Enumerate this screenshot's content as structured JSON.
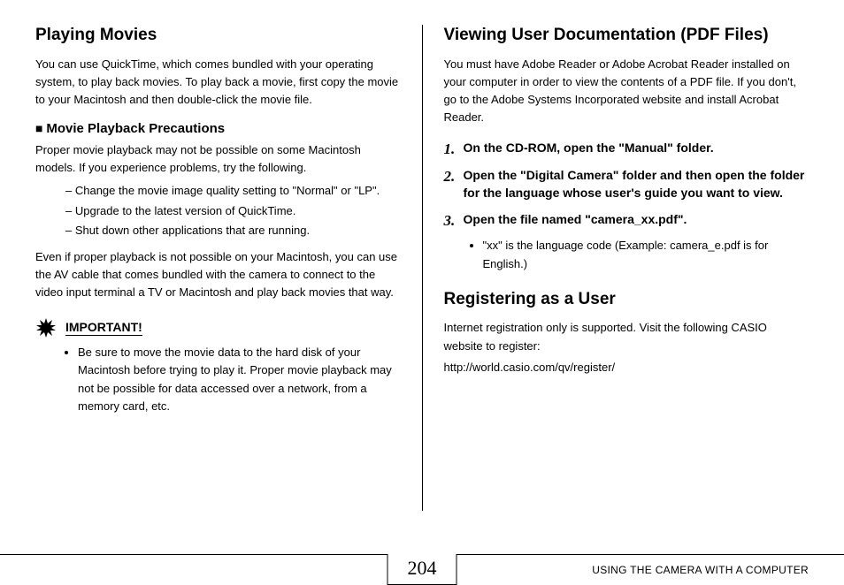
{
  "left": {
    "heading1": "Playing Movies",
    "para1": "You can use QuickTime, which comes bundled with your operating system, to play back movies. To play back a movie, first copy the movie to your Macintosh and then double-click the movie file.",
    "sub1": "Movie Playback Precautions",
    "para2": "Proper movie playback may not be possible on some Macintosh models. If you experience problems, try the following.",
    "dashes": [
      "Change the movie image quality setting to \"Normal\" or \"LP\".",
      "Upgrade to the latest version of QuickTime.",
      "Shut down other applications that are running."
    ],
    "para3": "Even if proper playback is not possible on your Macintosh, you can use the AV cable that comes bundled with the camera to connect to the video input terminal a TV or Macintosh and play back movies that way.",
    "important_label": "IMPORTANT!",
    "important_bullet": "Be sure to move the movie data to the hard disk of your Macintosh before trying to play it. Proper movie playback may not be possible for data accessed over a network, from a memory card, etc."
  },
  "right": {
    "heading1": "Viewing User Documentation (PDF Files)",
    "para1": "You must have Adobe Reader or Adobe Acrobat Reader installed on your computer in order to view the contents of a PDF file. If you don't, go to the Adobe Systems Incorporated website and install Acrobat Reader.",
    "steps": [
      {
        "n": "1.",
        "text": "On the CD-ROM, open the \"Manual\" folder."
      },
      {
        "n": "2.",
        "text": "Open the \"Digital Camera\" folder and then open the folder for the language whose user's guide you want to view."
      },
      {
        "n": "3.",
        "text": "Open the file named \"camera_xx.pdf\"."
      }
    ],
    "step3_note": "\"xx\" is the language code (Example: camera_e.pdf is for English.)",
    "heading2": "Registering as a User",
    "para2": "Internet registration only is supported. Visit the following CASIO website to register:",
    "url": "http://world.casio.com/qv/register/"
  },
  "footer": {
    "page": "204",
    "section": "USING THE CAMERA WITH A COMPUTER"
  }
}
